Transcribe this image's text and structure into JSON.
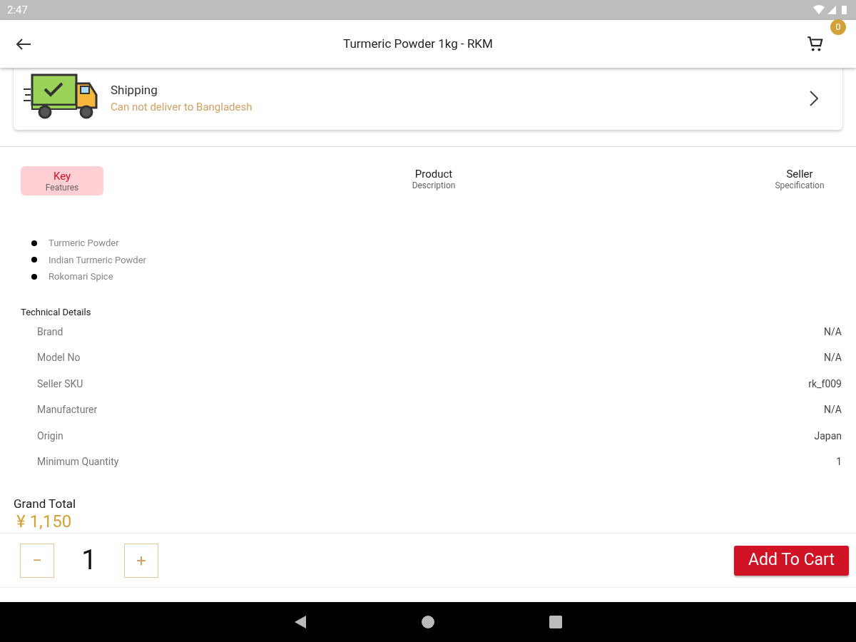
{
  "status_bar": {
    "time": "2:47"
  },
  "app_bar": {
    "title": "Turmeric Powder 1kg - RKM",
    "cart_count": "0"
  },
  "shipping": {
    "title": "Shipping",
    "message": "Can not deliver to Bangladesh"
  },
  "tabs": [
    {
      "label": "Key",
      "sublabel": "Features",
      "selected": true
    },
    {
      "label": "Product",
      "sublabel": "Description",
      "selected": false
    },
    {
      "label": "Seller",
      "sublabel": "Specification",
      "selected": false
    }
  ],
  "features": [
    "Turmeric Powder",
    "Indian Turmeric Powder",
    "Rokomari Spice"
  ],
  "technical_details": {
    "title": "Technical Details",
    "rows": [
      {
        "label": "Brand",
        "value": "N/A"
      },
      {
        "label": "Model No",
        "value": "N/A"
      },
      {
        "label": "Seller SKU",
        "value": "rk_f009"
      },
      {
        "label": "Manufacturer",
        "value": "N/A"
      },
      {
        "label": "Origin",
        "value": "Japan"
      },
      {
        "label": "Minimum Quantity",
        "value": "1"
      }
    ]
  },
  "grand_total": {
    "label": "Grand Total",
    "amount": "¥ 1,150"
  },
  "quantity": {
    "decrease": "−",
    "value": "1",
    "increase": "+"
  },
  "add_to_cart": "Add To Cart"
}
